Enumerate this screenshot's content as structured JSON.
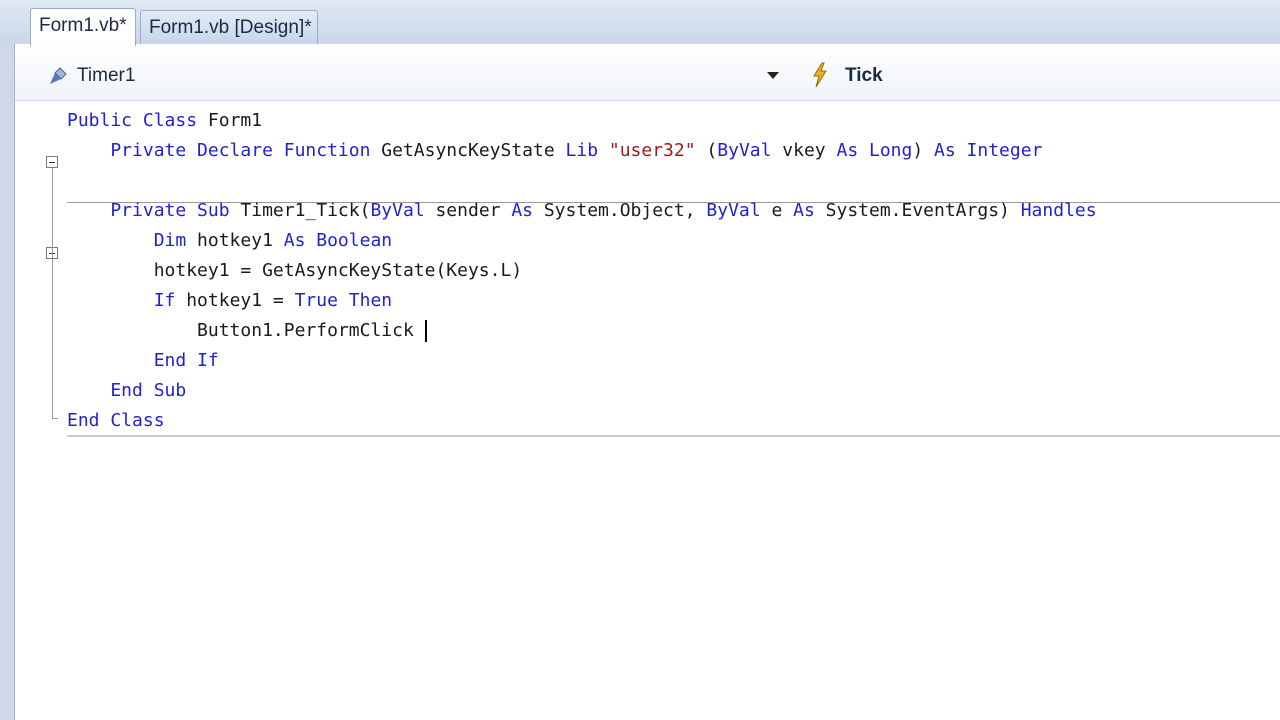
{
  "tabs": [
    {
      "label": "Form1.vb*"
    },
    {
      "label": "Form1.vb [Design]*"
    }
  ],
  "navbar": {
    "object_name": "Timer1",
    "event_name": "Tick",
    "object_icon": "timer-component-icon",
    "event_icon": "lightning-event-icon"
  },
  "code_lines": [
    [
      {
        "t": "Public Class ",
        "c": "kw"
      },
      {
        "t": "Form1",
        "c": ""
      }
    ],
    [
      {
        "t": "    Private Declare Function ",
        "c": "kw"
      },
      {
        "t": "GetAsyncKeyState ",
        "c": ""
      },
      {
        "t": "Lib ",
        "c": "kw"
      },
      {
        "t": "\"user32\"",
        "c": "str"
      },
      {
        "t": " (",
        "c": ""
      },
      {
        "t": "ByVal ",
        "c": "kw"
      },
      {
        "t": "vkey ",
        "c": ""
      },
      {
        "t": "As Long",
        "c": "kw"
      },
      {
        "t": ") ",
        "c": ""
      },
      {
        "t": "As Integer",
        "c": "kw"
      }
    ],
    [],
    [
      {
        "t": "    Private Sub ",
        "c": "kw"
      },
      {
        "t": "Timer1_Tick(",
        "c": ""
      },
      {
        "t": "ByVal ",
        "c": "kw"
      },
      {
        "t": "sender ",
        "c": ""
      },
      {
        "t": "As ",
        "c": "kw"
      },
      {
        "t": "System.Object, ",
        "c": ""
      },
      {
        "t": "ByVal ",
        "c": "kw"
      },
      {
        "t": "e ",
        "c": ""
      },
      {
        "t": "As ",
        "c": "kw"
      },
      {
        "t": "System.EventArgs) ",
        "c": ""
      },
      {
        "t": "Handles",
        "c": "kw"
      }
    ],
    [
      {
        "t": "        Dim ",
        "c": "kw"
      },
      {
        "t": "hotkey1 ",
        "c": ""
      },
      {
        "t": "As Boolean",
        "c": "kw"
      }
    ],
    [
      {
        "t": "        hotkey1 = GetAsyncKeyState(Keys.L)",
        "c": ""
      }
    ],
    [
      {
        "t": "        If ",
        "c": "kw"
      },
      {
        "t": "hotkey1 = ",
        "c": ""
      },
      {
        "t": "True Then",
        "c": "kw"
      }
    ],
    [
      {
        "t": "            Button1.PerformClick ",
        "c": ""
      }
    ],
    [
      {
        "t": "        End If",
        "c": "kw"
      }
    ],
    [
      {
        "t": "    End Sub",
        "c": "kw"
      }
    ],
    [
      {
        "t": "End Class",
        "c": "kw"
      }
    ]
  ],
  "colors": {
    "keyword": "#2121d6",
    "string": "#a11a1a",
    "text": "#1a1a1a"
  }
}
